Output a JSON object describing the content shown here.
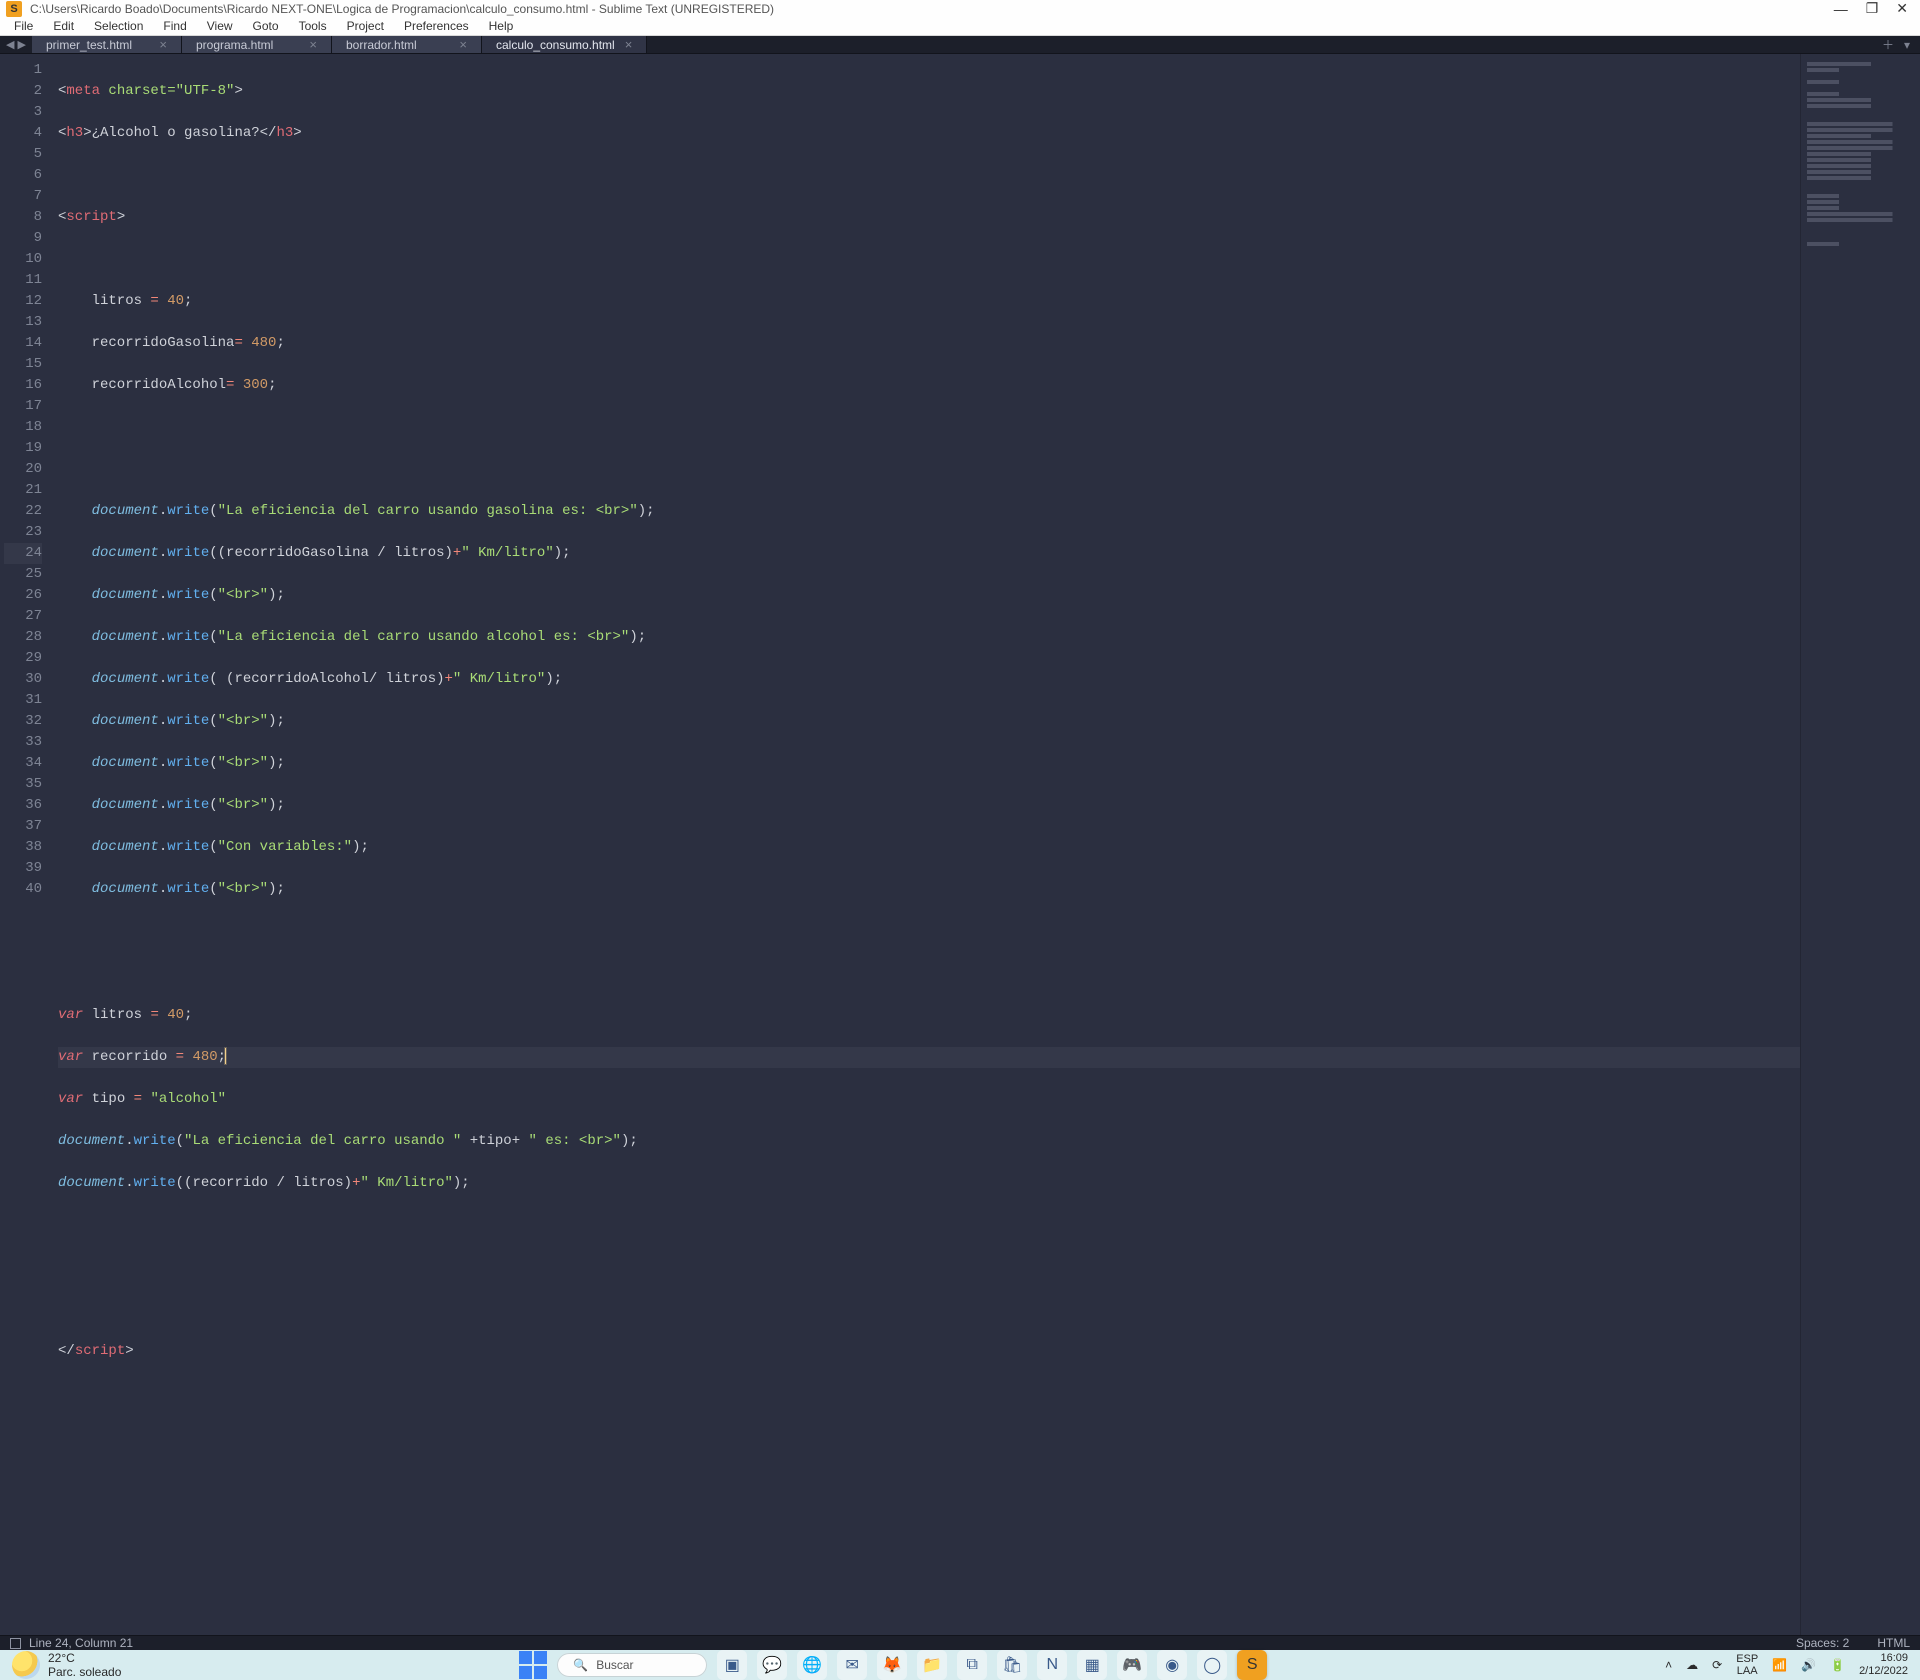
{
  "window": {
    "title": "C:\\Users\\Ricardo Boado\\Documents\\Ricardo NEXT-ONE\\Logica de Programacion\\calculo_consumo.html - Sublime Text (UNREGISTERED)",
    "app_badge": "S"
  },
  "menu": [
    "File",
    "Edit",
    "Selection",
    "Find",
    "View",
    "Goto",
    "Tools",
    "Project",
    "Preferences",
    "Help"
  ],
  "tabs": [
    {
      "label": "primer_test.html",
      "active": false
    },
    {
      "label": "programa.html",
      "active": false
    },
    {
      "label": "borrador.html",
      "active": false
    },
    {
      "label": "calculo_consumo.html",
      "active": true
    }
  ],
  "status": {
    "pos": "Line 24, Column 21",
    "spaces": "Spaces: 2",
    "lang": "HTML"
  },
  "taskbar": {
    "temp": "22°C",
    "weather": "Parc. soleado",
    "search_placeholder": "Buscar",
    "lang_top": "ESP",
    "lang_bot": "LAA",
    "time": "16:09",
    "date": "2/12/2022"
  },
  "code": {
    "line1_tag": "meta",
    "line1_attr": "charset=",
    "line1_val": "\"UTF-8\"",
    "line2_open": "h3",
    "line2_text": "¿Alcohol o gasolina?",
    "line2_close": "h3",
    "line4_tag": "script",
    "line6": "    litros ",
    "line6_op": "=",
    "line6_num": " 40",
    "line6_end": ";",
    "line7": "    recorridoGasolina",
    "line7_op": "= ",
    "line7_num": "480",
    "line7_end": ";",
    "line8": "    recorridoAlcohol",
    "line8_op": "= ",
    "line8_num": "300",
    "line8_end": ";",
    "line11_str": "\"La eficiencia del carro usando gasolina es: <br>\"",
    "line12_expr": "(recorridoGasolina / litros)",
    "line12_plus": "+",
    "line12_str": "\" Km/litro\"",
    "line13_str": "\"<br>\"",
    "line14_str": "\"La eficiencia del carro usando alcohol es: <br>\"",
    "line15_expr": " (recorridoAlcohol/ litros)",
    "line15_plus": "+",
    "line15_str": "\" Km/litro\"",
    "line19_str": "\"Con variables:\"",
    "line23_var": "var",
    "line23_id": " litros ",
    "line23_op": "= ",
    "line23_num": "40",
    "line23_end": ";",
    "line24_var": "var",
    "line24_id": " recorrido ",
    "line24_op": "= ",
    "line24_num": "480",
    "line24_end": ";",
    "line25_var": "var",
    "line25_id": " tipo ",
    "line25_op": "= ",
    "line25_str": "\"alcohol\"",
    "line26_str1": "\"La eficiencia del carro usando \"",
    "line26_mid": " +tipo+ ",
    "line26_str2": "\" es: <br>\"",
    "line27_expr": "(recorrido / litros)",
    "line27_plus": "+",
    "line27_str": "\" Km/litro\"",
    "line31_close": "script",
    "doc": "document",
    "write": "write"
  }
}
